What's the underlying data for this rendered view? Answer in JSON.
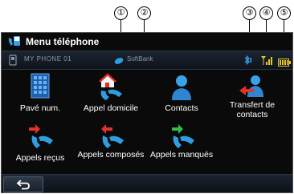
{
  "callouts": [
    "①",
    "②",
    "③",
    "④",
    "⑤"
  ],
  "title": "Menu téléphone",
  "status": {
    "phone_name": "MY PHONE 01",
    "carrier": "SoftBank"
  },
  "tiles": [
    {
      "label": "Pavé num.",
      "icon": "keypad-icon"
    },
    {
      "label": "Appel domicile",
      "icon": "call-home-icon"
    },
    {
      "label": "Contacts",
      "icon": "contacts-icon"
    },
    {
      "label": "Transfert de contacts",
      "icon": "contact-transfer-icon"
    },
    {
      "label": "Appels reçus",
      "icon": "received-calls-icon"
    },
    {
      "label": "Appels composés",
      "icon": "dialed-calls-icon"
    },
    {
      "label": "Appels manqués",
      "icon": "missed-calls-icon"
    }
  ],
  "colors": {
    "background": "#0a0a0a",
    "text": "#ffffff",
    "accent": "#2f9ee0",
    "arrow_red": "#e0322a",
    "arrow_green": "#2fbf4a"
  }
}
